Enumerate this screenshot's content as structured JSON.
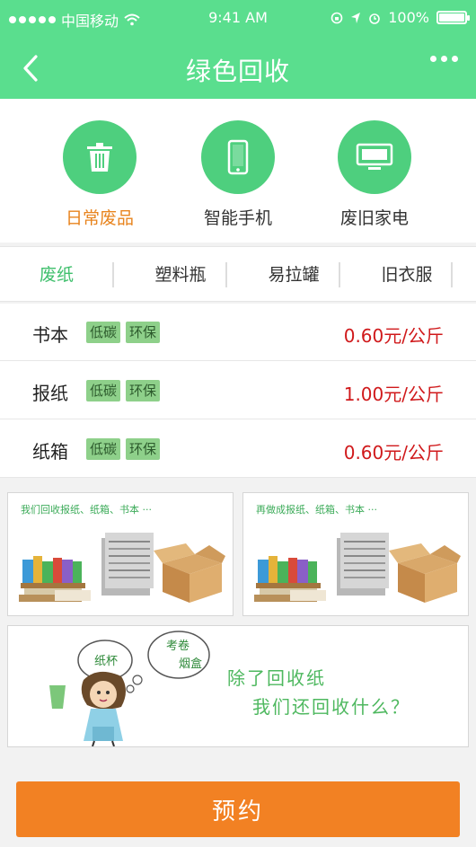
{
  "status_bar": {
    "carrier": "中国移动",
    "time": "9:41 AM",
    "battery_text": "100%",
    "battery_level": 1.0
  },
  "nav": {
    "title": "绿色回收",
    "back_icon": "chevron-left-icon",
    "more_icon": "more-dots-icon"
  },
  "categories": [
    {
      "label": "日常废品",
      "icon": "trash-can-icon",
      "active": true
    },
    {
      "label": "智能手机",
      "icon": "smartphone-icon",
      "active": false
    },
    {
      "label": "废旧家电",
      "icon": "monitor-icon",
      "active": false
    }
  ],
  "tabs": [
    {
      "label": "废纸",
      "active": true
    },
    {
      "label": "塑料瓶",
      "active": false
    },
    {
      "label": "易拉罐",
      "active": false
    },
    {
      "label": "旧衣服",
      "active": false
    }
  ],
  "price_items": [
    {
      "name": "书本",
      "tags": [
        "低碳",
        "环保"
      ],
      "price": "0.60元/公斤"
    },
    {
      "name": "报纸",
      "tags": [
        "低碳",
        "环保"
      ],
      "price": "1.00元/公斤"
    },
    {
      "name": "纸箱",
      "tags": [
        "低碳",
        "环保"
      ],
      "price": "0.60元/公斤"
    }
  ],
  "banners": [
    {
      "caption": "我们回收报纸、纸箱、书本 ···"
    },
    {
      "caption": "再做成报纸、纸箱、书本 ···"
    }
  ],
  "promo": {
    "bubble_1": "纸杯",
    "bubble_2_line1": "考卷",
    "bubble_2_line2": "烟盒",
    "line1": "除了回收纸",
    "line2": "我们还回收什么？"
  },
  "book_button": {
    "label": "预约"
  },
  "colors": {
    "header_green": "#5ade8e",
    "icon_green": "#4ecf7e",
    "active_orange": "#e8841e",
    "tab_active": "#3fbf6c",
    "price_red": "#d0191b",
    "tag_green": "#8ed08a",
    "button_orange": "#f28123"
  }
}
